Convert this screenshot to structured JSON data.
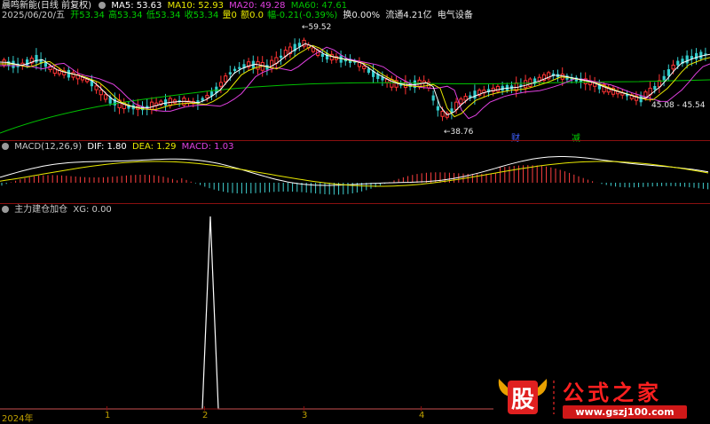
{
  "stock": {
    "name": "晨鸣新能(日线 前复权)",
    "date": "2025/06/20/五",
    "open_label": "开",
    "open": "53.34",
    "high_label": "高",
    "high": "53.34",
    "low_label": "低",
    "low": "53.34",
    "close_label": "收",
    "close": "53.34",
    "vol_label": "量0",
    "amt_label": "额0.0",
    "change": "幅-0.21(-0.39%)",
    "turnover": "换0.00%",
    "float_cap": "流通4.21亿",
    "sector": "电气设备"
  },
  "ma": {
    "ma5": "MA5: 53.63",
    "ma10": "MA10: 52.93",
    "ma20": "MA20: 49.28",
    "ma60": "MA60: 47.61"
  },
  "annotations": {
    "high_price": "59.52",
    "low_price": "38.76",
    "range": "45.08 - 45.54",
    "tag_cai": "财",
    "tag_jian": "减"
  },
  "macd": {
    "title": "MACD(12,26,9)",
    "dif": "DIF: 1.80",
    "dea": "DEA: 1.29",
    "macd": "MACD: 1.03"
  },
  "indicator": {
    "title": "主力建仓加仓",
    "xg": "XG: 0.00"
  },
  "x_axis": {
    "labels": [
      "2024年",
      "1",
      "2",
      "3",
      "4"
    ]
  },
  "watermark": {
    "brand_char": "股",
    "brand_text": "公式之家",
    "url": "www.gszj100.com"
  },
  "colors": {
    "background": "#000000",
    "up": "#ff3333",
    "down": "#33cccc",
    "ma5": "#ffffff",
    "ma10": "#e8e800",
    "ma20": "#e040e0",
    "ma60": "#00c000",
    "separator": "#8a1010"
  }
}
